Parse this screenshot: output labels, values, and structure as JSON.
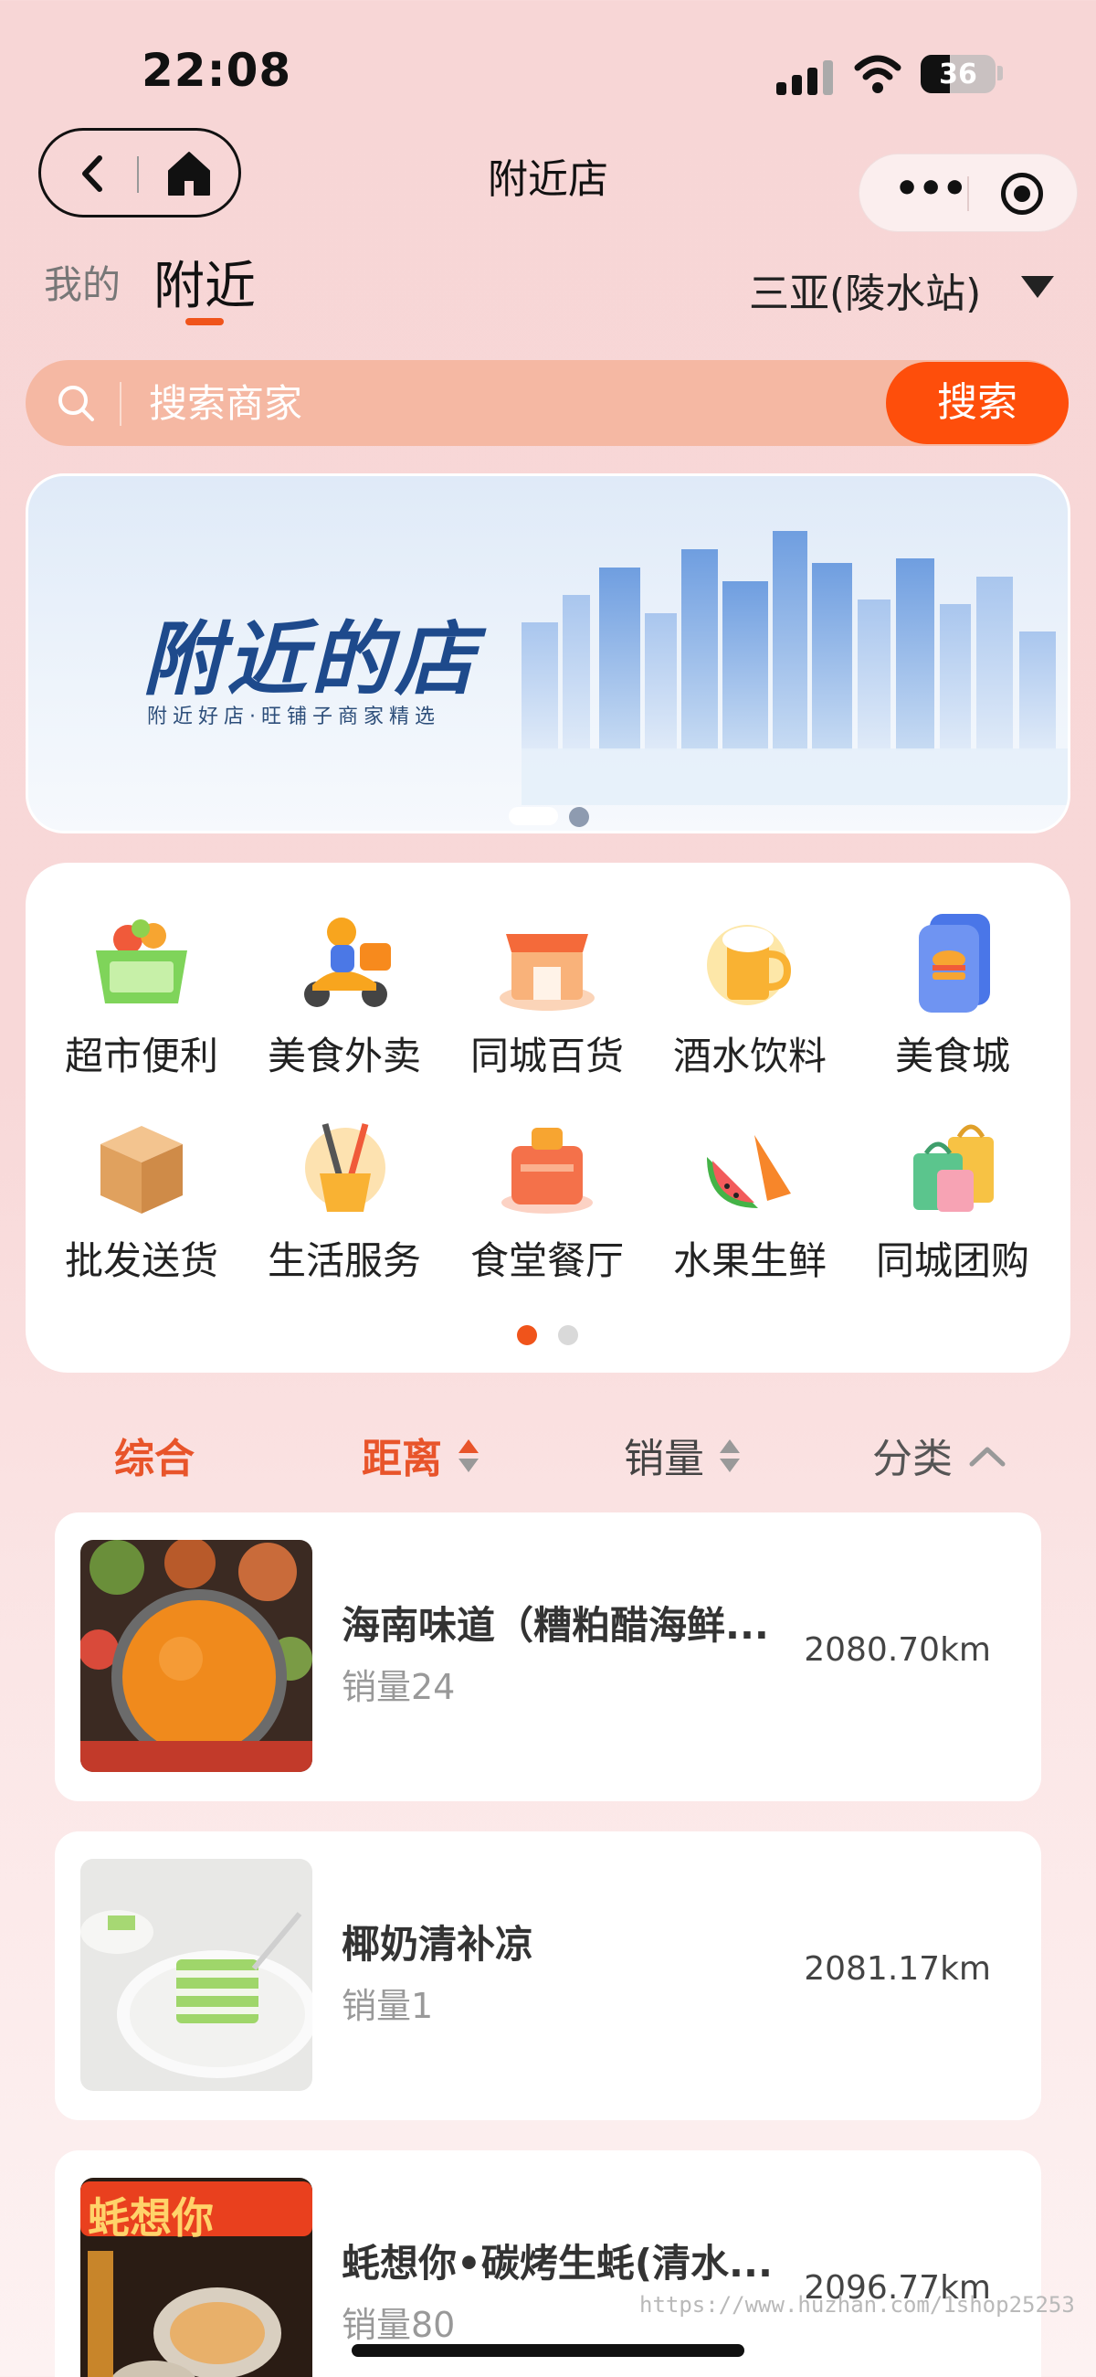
{
  "status_bar": {
    "time": "22:08",
    "battery": "36"
  },
  "nav": {
    "title": "附近店"
  },
  "tabs": {
    "mine": "我的",
    "nearby": "附近"
  },
  "location": {
    "city": "三亚(陵水站)"
  },
  "search": {
    "placeholder": "搜索商家",
    "button": "搜索"
  },
  "banner": {
    "title": "附近的店",
    "subtitle": "附近好店·旺铺子商家精选"
  },
  "categories": [
    {
      "label": "超市便利",
      "icon": "grocery-basket-icon"
    },
    {
      "label": "美食外卖",
      "icon": "delivery-scooter-icon"
    },
    {
      "label": "同城百货",
      "icon": "store-front-icon"
    },
    {
      "label": "酒水饮料",
      "icon": "beer-mug-icon"
    },
    {
      "label": "美食城",
      "icon": "burger-card-icon"
    },
    {
      "label": "批发送货",
      "icon": "cardboard-box-icon"
    },
    {
      "label": "生活服务",
      "icon": "cleaning-tools-icon"
    },
    {
      "label": "食堂餐厅",
      "icon": "canteen-icon"
    },
    {
      "label": "水果生鲜",
      "icon": "watermelon-carrot-icon"
    },
    {
      "label": "同城团购",
      "icon": "shopping-bags-icon"
    }
  ],
  "sort": {
    "comprehensive": "综合",
    "distance": "距离",
    "sales": "销量",
    "category": "分类"
  },
  "shops": [
    {
      "name": "海南味道（糟粕醋海鲜...",
      "sales": "销量24",
      "distance": "2080.70km"
    },
    {
      "name": "椰奶清补凉",
      "sales": "销量1",
      "distance": "2081.17km"
    },
    {
      "name": "蚝想你•碳烤生蚝(清水...",
      "sales": "销量80",
      "distance": "2096.77km",
      "thumb_text": "蚝想你"
    }
  ],
  "watermark": "https://www.huzhan.com/1shop25253",
  "colors": {
    "accent": "#fe4e0b",
    "sort_active": "#e8542a",
    "background": "#f7d6d6"
  }
}
